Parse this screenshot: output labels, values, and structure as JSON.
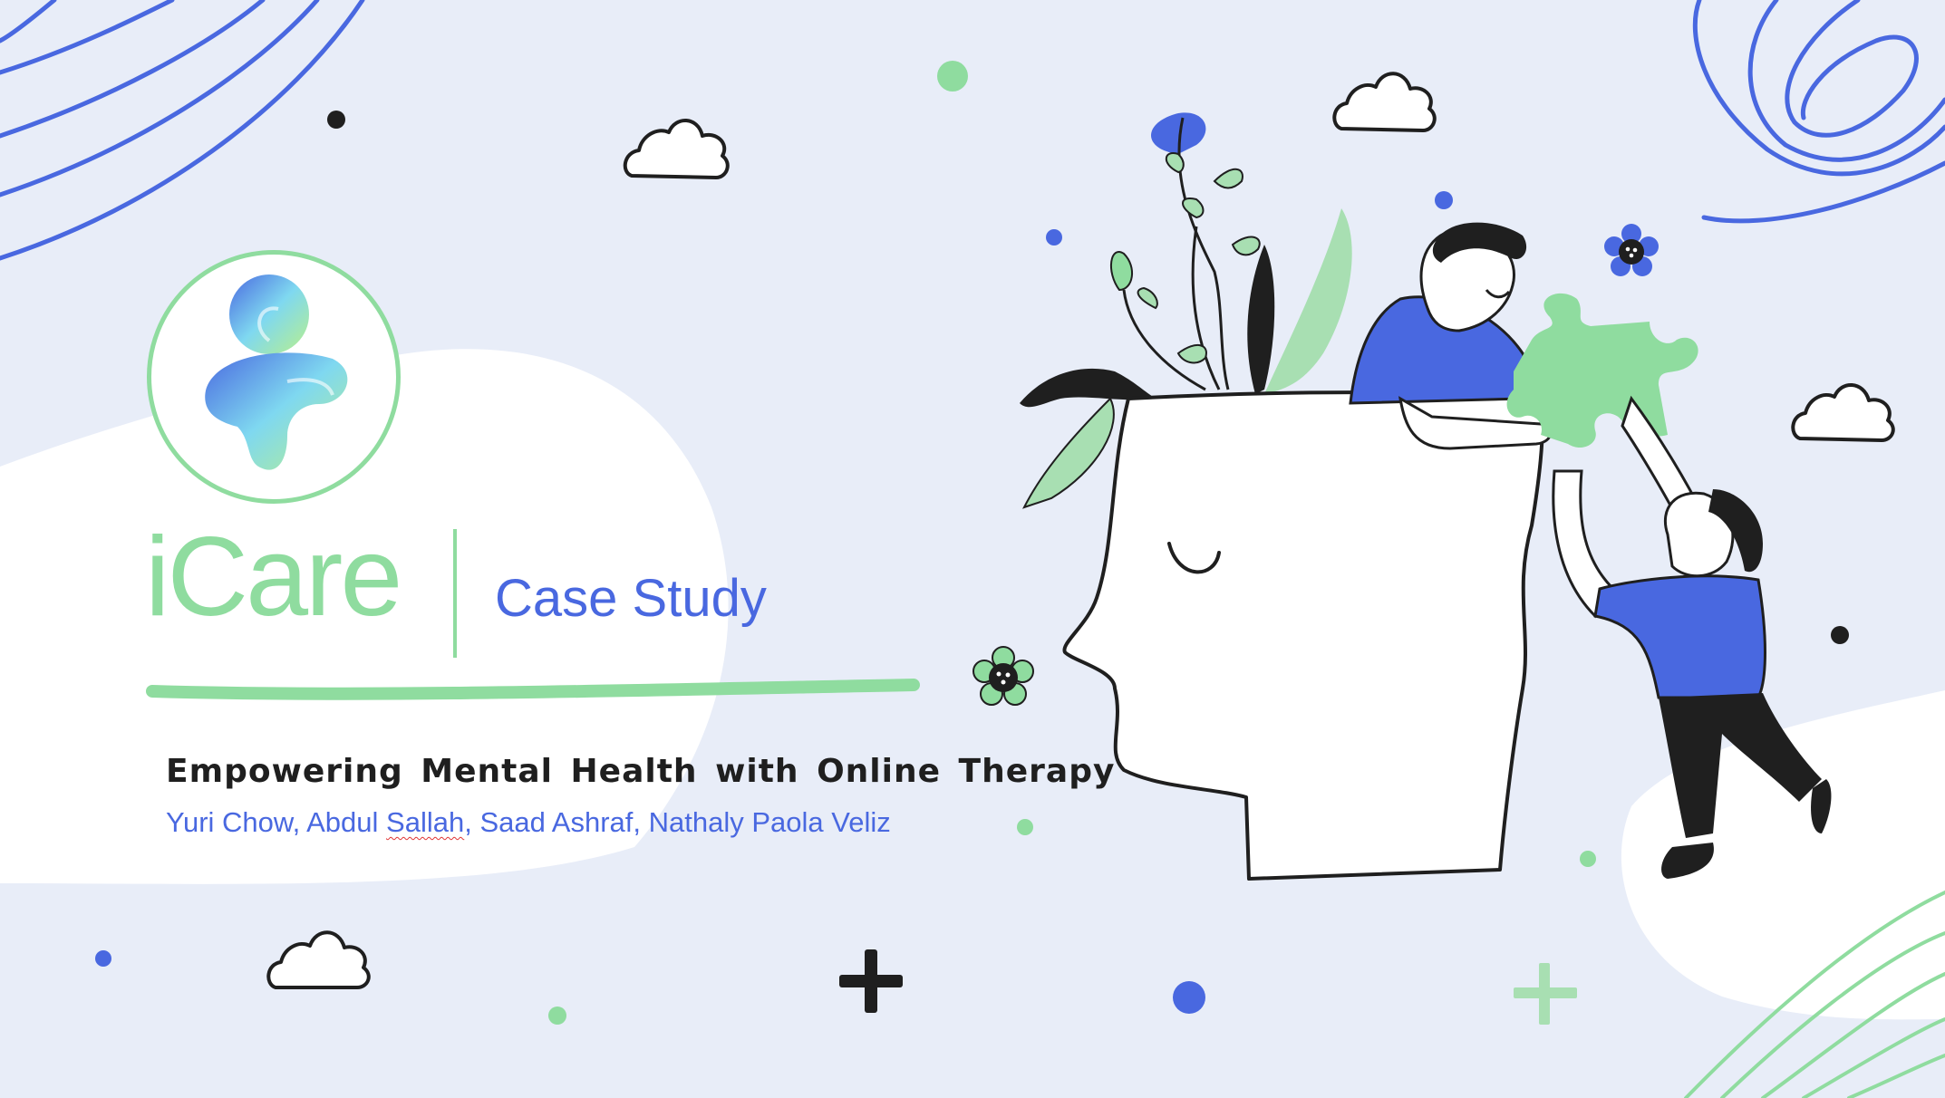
{
  "slide": {
    "brand": "iCare",
    "subtitle": "Case Study",
    "tagline": "Empowering Mental Health with Online Therapy",
    "authors": {
      "a1": "Yuri Chow,",
      "a2_first": "Abdul",
      "a2_last": "Sallah",
      "a2_comma": ",",
      "a3": "Saad Ashraf,",
      "a4": "Nathaly Paola Veliz"
    }
  },
  "colors": {
    "background": "#e8edf8",
    "accent_green": "#8fdc9f",
    "accent_blue": "#4968e0",
    "ink": "#1f1f1f"
  },
  "icons": [
    "logo-icon",
    "cloud-icon",
    "flower-icon",
    "puzzle-piece-icon",
    "plus-icon",
    "head-illustration",
    "person-illustration"
  ]
}
